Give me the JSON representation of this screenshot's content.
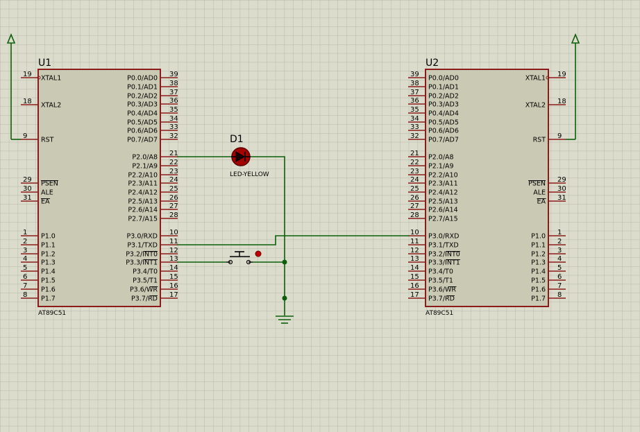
{
  "colors": {
    "background": "#dcdccc",
    "grid": "#b9b9aa",
    "chip_outline": "#8b1a1a",
    "chip_fill": "#c9c9b4",
    "wire": "#0a5e0a",
    "led": "#a30000"
  },
  "chips": [
    {
      "ref": "U1",
      "part": "AT89C51",
      "left_pins": [
        {
          "num": "19",
          "label": "XTAL1"
        },
        {
          "num": "18",
          "label": "XTAL2"
        },
        {
          "num": "9",
          "label": "RST"
        },
        {
          "num": "29",
          "label": "PSEN"
        },
        {
          "num": "30",
          "label": "ALE"
        },
        {
          "num": "31",
          "label": "EA"
        },
        {
          "num": "1",
          "label": "P1.0"
        },
        {
          "num": "2",
          "label": "P1.1"
        },
        {
          "num": "3",
          "label": "P1.2"
        },
        {
          "num": "4",
          "label": "P1.3"
        },
        {
          "num": "5",
          "label": "P1.4"
        },
        {
          "num": "6",
          "label": "P1.5"
        },
        {
          "num": "7",
          "label": "P1.6"
        },
        {
          "num": "8",
          "label": "P1.7"
        }
      ],
      "right_pins": [
        {
          "num": "39",
          "label": "P0.0/AD0"
        },
        {
          "num": "38",
          "label": "P0.1/AD1"
        },
        {
          "num": "37",
          "label": "P0.2/AD2"
        },
        {
          "num": "36",
          "label": "P0.3/AD3"
        },
        {
          "num": "35",
          "label": "P0.4/AD4"
        },
        {
          "num": "34",
          "label": "P0.5/AD5"
        },
        {
          "num": "33",
          "label": "P0.6/AD6"
        },
        {
          "num": "32",
          "label": "P0.7/AD7"
        },
        {
          "num": "21",
          "label": "P2.0/A8"
        },
        {
          "num": "22",
          "label": "P2.1/A9"
        },
        {
          "num": "23",
          "label": "P2.2/A10"
        },
        {
          "num": "24",
          "label": "P2.3/A11"
        },
        {
          "num": "25",
          "label": "P2.4/A12"
        },
        {
          "num": "26",
          "label": "P2.5/A13"
        },
        {
          "num": "27",
          "label": "P2.6/A14"
        },
        {
          "num": "28",
          "label": "P2.7/A15"
        },
        {
          "num": "10",
          "label": "P3.0/RXD"
        },
        {
          "num": "11",
          "label": "P3.1/TXD"
        },
        {
          "num": "12",
          "label": "P3.2/INT0"
        },
        {
          "num": "13",
          "label": "P3.3/INT1"
        },
        {
          "num": "14",
          "label": "P3.4/T0"
        },
        {
          "num": "15",
          "label": "P3.5/T1"
        },
        {
          "num": "16",
          "label": "P3.6/WR"
        },
        {
          "num": "17",
          "label": "P3.7/RD"
        }
      ]
    },
    {
      "ref": "U2",
      "part": "AT89C51",
      "left_pins": [
        {
          "num": "39",
          "label": "P0.0/AD0"
        },
        {
          "num": "38",
          "label": "P0.1/AD1"
        },
        {
          "num": "37",
          "label": "P0.2/AD2"
        },
        {
          "num": "36",
          "label": "P0.3/AD3"
        },
        {
          "num": "35",
          "label": "P0.4/AD4"
        },
        {
          "num": "34",
          "label": "P0.5/AD5"
        },
        {
          "num": "33",
          "label": "P0.6/AD6"
        },
        {
          "num": "32",
          "label": "P0.7/AD7"
        },
        {
          "num": "21",
          "label": "P2.0/A8"
        },
        {
          "num": "22",
          "label": "P2.1/A9"
        },
        {
          "num": "23",
          "label": "P2.2/A10"
        },
        {
          "num": "24",
          "label": "P2.3/A11"
        },
        {
          "num": "25",
          "label": "P2.4/A12"
        },
        {
          "num": "26",
          "label": "P2.5/A13"
        },
        {
          "num": "27",
          "label": "P2.6/A14"
        },
        {
          "num": "28",
          "label": "P2.7/A15"
        },
        {
          "num": "10",
          "label": "P3.0/RXD"
        },
        {
          "num": "11",
          "label": "P3.1/TXD"
        },
        {
          "num": "12",
          "label": "P3.2/INT0"
        },
        {
          "num": "13",
          "label": "P3.3/INT1"
        },
        {
          "num": "14",
          "label": "P3.4/T0"
        },
        {
          "num": "15",
          "label": "P3.5/T1"
        },
        {
          "num": "16",
          "label": "P3.6/WR"
        },
        {
          "num": "17",
          "label": "P3.7/RD"
        }
      ],
      "right_pins": [
        {
          "num": "19",
          "label": "XTAL1"
        },
        {
          "num": "18",
          "label": "XTAL2"
        },
        {
          "num": "9",
          "label": "RST"
        },
        {
          "num": "29",
          "label": "PSEN"
        },
        {
          "num": "30",
          "label": "ALE"
        },
        {
          "num": "31",
          "label": "EA"
        },
        {
          "num": "1",
          "label": "P1.0"
        },
        {
          "num": "2",
          "label": "P1.1"
        },
        {
          "num": "3",
          "label": "P1.2"
        },
        {
          "num": "4",
          "label": "P1.3"
        },
        {
          "num": "5",
          "label": "P1.4"
        },
        {
          "num": "6",
          "label": "P1.5"
        },
        {
          "num": "7",
          "label": "P1.6"
        },
        {
          "num": "8",
          "label": "P1.7"
        }
      ]
    }
  ],
  "led": {
    "ref": "D1",
    "part": "LED-YELLOW"
  }
}
